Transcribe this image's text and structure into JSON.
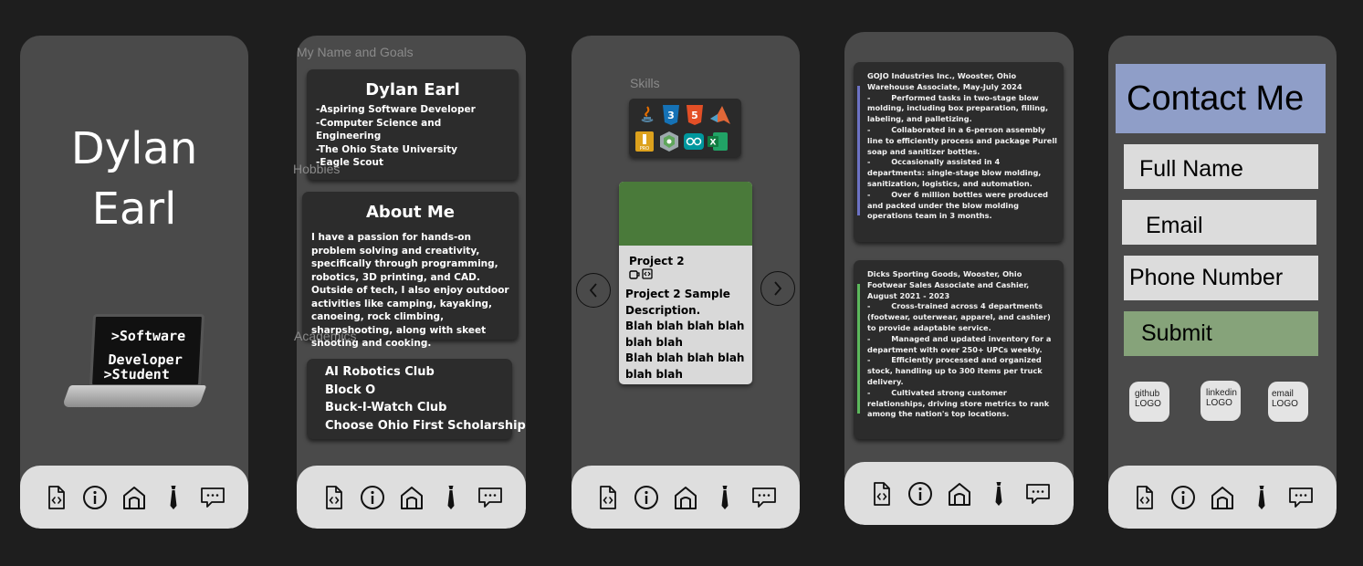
{
  "nav": {
    "icons": [
      "document-code-icon",
      "info-icon",
      "home-icon",
      "tie-icon",
      "chat-icon"
    ]
  },
  "screen1": {
    "name_line1": "Dylan",
    "name_line2": "Earl",
    "laptop_line1": ">Software",
    "laptop_line2": "Developer",
    "laptop_line3": ">Student"
  },
  "screen2": {
    "section_label": "My Name and Goals",
    "hobbies_label": "Hobbies",
    "academics_label": "Academics",
    "name_title": "Dylan Earl",
    "goals": [
      "-Aspiring Software Developer",
      "-Computer Science and",
      "Engineering",
      "-The Ohio State University",
      "-Eagle Scout"
    ],
    "about_title": "About Me",
    "about_text": "I have a passion for hands-on problem solving and creativity, specifically through programming, robotics, 3D printing, and CAD. Outside of tech, I also enjoy outdoor activities like camping, kayaking, canoeing, rock climbing, sharpshooting, along with skeet shooting and cooking.",
    "academics": [
      "AI Robotics Club",
      "Block O",
      "Buck-I-Watch Club",
      "Choose Ohio First Scholarship"
    ]
  },
  "screen3": {
    "skills_label": "Skills",
    "skill_icons": [
      "java-icon",
      "css3-icon",
      "html5-icon",
      "matlab-icon",
      "inventor-pro-icon",
      "fusion-icon",
      "arduino-icon",
      "excel-icon"
    ],
    "project_title": "Project 2",
    "project_desc": [
      "Project 2 Sample",
      "Description.",
      "Blah blah blah blah",
      "blah blah",
      "Blah blah blah blah",
      "blah blah"
    ],
    "project_color": "#4a7a3a"
  },
  "screen4": {
    "job1": [
      "GOJO Industries Inc., Wooster, Ohio",
      "Warehouse Associate, May-July 2024",
      "-        Performed tasks in two-stage blow molding, including box preparation, filling, labeling, and palletizing.",
      "-        Collaborated in a 6-person assembly line to efficiently process and package Purell soap and sanitizer bottles.",
      "-        Occasionally assisted in 4 departments: single-stage blow molding, sanitization, logistics, and automation.",
      "-        Over 6 million bottles were produced and packed under the blow molding operations team in 3 months."
    ],
    "job2": [
      "Dicks Sporting Goods, Wooster, Ohio",
      "Footwear Sales Associate and Cashier, August 2021 - 2023",
      "-        Cross-trained across 4 departments (footwear, outerwear, apparel, and cashier) to provide adaptable service.",
      "-        Managed and updated inventory for a department with over 250+ UPCs weekly.",
      "-        Efficiently processed and organized stock, handling up to 300 items per truck delivery.",
      "-        Cultivated strong customer relationships, driving store metrics to rank among the nation's top locations."
    ],
    "accent1": "#6c72c4",
    "accent2": "#5cb85c"
  },
  "screen5": {
    "title": "Contact Me",
    "full_name": "Full Name",
    "email": "Email",
    "phone": "Phone Number",
    "submit": "Submit",
    "github_line1": "github",
    "github_line2": "LOGO",
    "linkedin_line1": "linkedin",
    "linkedin_line2": "LOGO",
    "email_line1": "email",
    "email_line2": "LOGO",
    "title_bg": "#8f9ec8",
    "submit_bg": "#86a37a"
  }
}
